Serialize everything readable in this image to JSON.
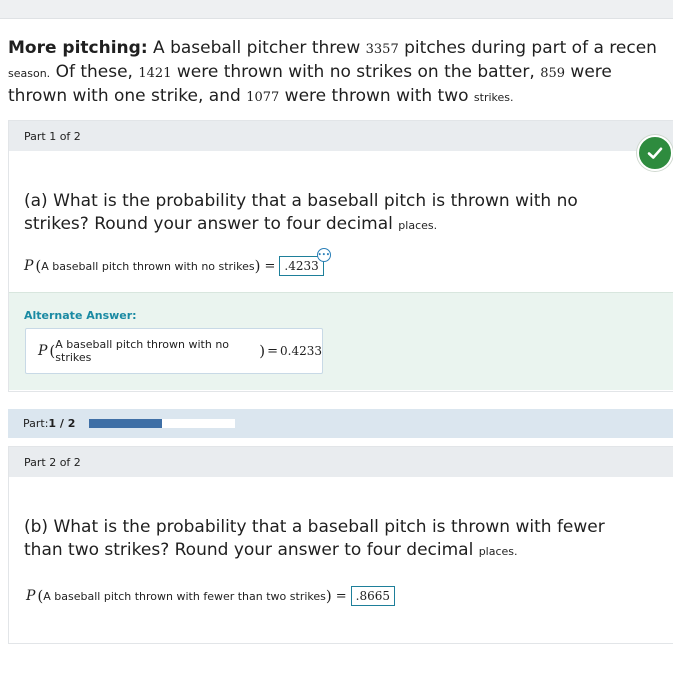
{
  "problem": {
    "title": "More pitching:",
    "text_1": " A baseball pitcher threw ",
    "total": "3357",
    "text_2": " pitches during part of a recen",
    "text_3": "season.",
    "text_4": " Of these, ",
    "no_strikes": "1421",
    "text_5": " were thrown with no strikes on the batter, ",
    "one_strike": "859",
    "text_6": " were",
    "text_7": "thrown with one strike, and ",
    "two_strikes": "1077",
    "text_8": " were thrown with two ",
    "text_9": "strikes."
  },
  "part1": {
    "header": "Part 1 of 2",
    "question_line1": "(a) What is the probability that a baseball pitch is thrown with no",
    "question_line2": "strikes? Round your answer to four decimal ",
    "question_small": "places.",
    "P": "P",
    "event": "A baseball pitch thrown with no strikes",
    "answer": ".4233",
    "more_icon": "ellipsis-icon",
    "status_icon": "checkmark-icon",
    "status_color": "#2e8b3e"
  },
  "alternate": {
    "title": "Alternate Answer:",
    "P": "P",
    "event": "A baseball pitch thrown with no strikes",
    "value": "0.4233"
  },
  "progress": {
    "label": "Part: ",
    "value_text": "1 / 2",
    "fraction": 0.5,
    "fill_color": "#3e6fa6"
  },
  "part2": {
    "header": "Part 2 of 2",
    "question_line1": "(b) What is the probability that a baseball pitch is thrown with fewer",
    "question_line2": "than two strikes? Round your answer to four decimal ",
    "question_small": "places.",
    "P": "P",
    "event": "A baseball pitch thrown with fewer than two strikes",
    "answer": ".8665"
  }
}
